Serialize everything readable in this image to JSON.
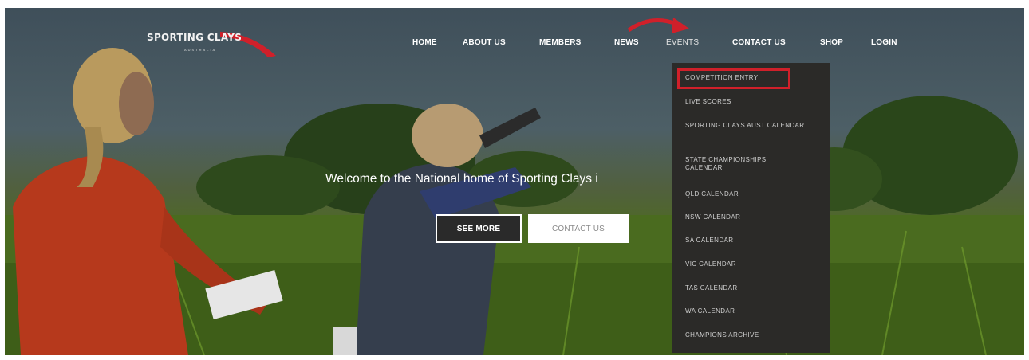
{
  "brand": {
    "logo_text": "SPORTING CLAYS",
    "logo_subtext": "AUSTRALIA"
  },
  "nav": {
    "items": [
      {
        "label": "HOME"
      },
      {
        "label": "ABOUT US"
      },
      {
        "label": "MEMBERS"
      },
      {
        "label": "NEWS"
      },
      {
        "label": "EVENTS"
      },
      {
        "label": "CONTACT US"
      },
      {
        "label": "SHOP"
      },
      {
        "label": "LOGIN"
      }
    ],
    "active": "EVENTS"
  },
  "dropdown": {
    "items": [
      {
        "label": "COMPETITION ENTRY"
      },
      {
        "label": "LIVE SCORES"
      },
      {
        "label": "SPORTING CLAYS AUST CALENDAR"
      },
      {
        "label": "STATE CHAMPIONSHIPS CALENDAR"
      },
      {
        "label": "QLD CALENDAR"
      },
      {
        "label": "NSW CALENDAR"
      },
      {
        "label": "SA CALENDAR"
      },
      {
        "label": "VIC CALENDAR"
      },
      {
        "label": "TAS CALENDAR"
      },
      {
        "label": "WA CALENDAR"
      },
      {
        "label": "CHAMPIONS ARCHIVE"
      }
    ],
    "highlighted": "COMPETITION ENTRY"
  },
  "hero": {
    "headline": "Welcome to the National home of Sporting Clays i",
    "buttons": {
      "see_more": "SEE MORE",
      "contact_us": "CONTACT US"
    }
  },
  "colors": {
    "annotation_red": "#d0202a",
    "dropdown_bg": "#2b2a28",
    "nav_text": "#ffffff"
  }
}
